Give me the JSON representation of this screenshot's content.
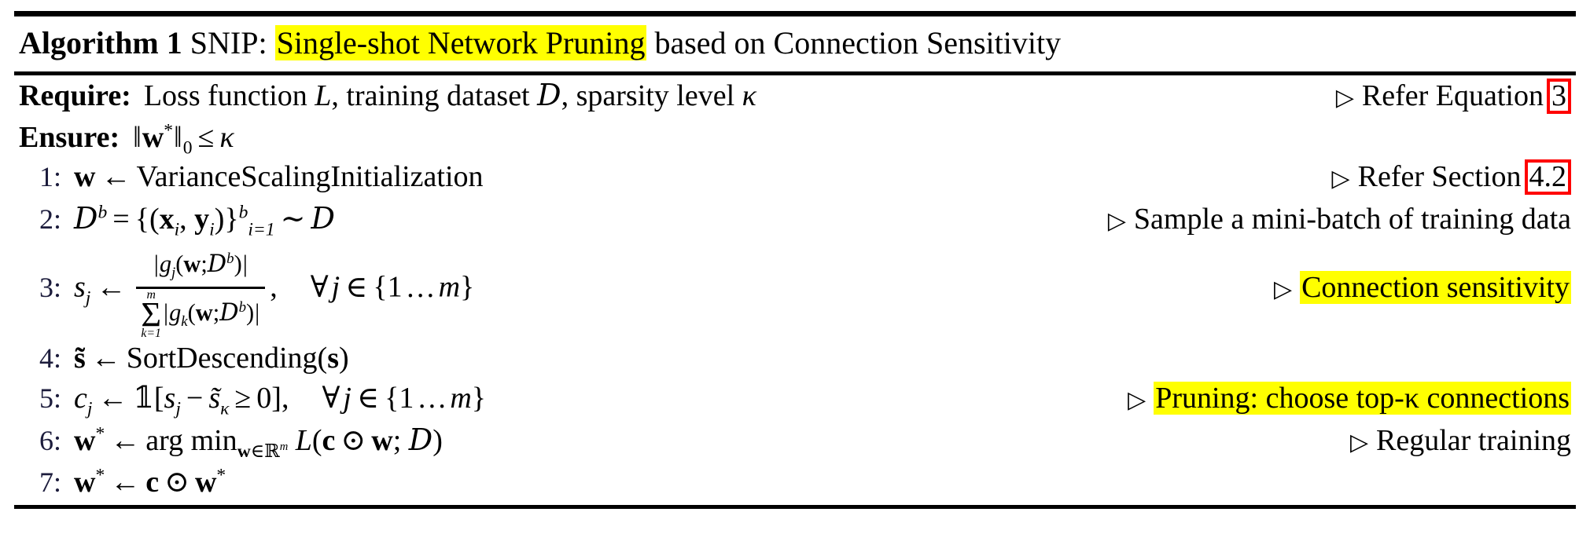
{
  "title": {
    "label": "Algorithm 1",
    "name": "SNIP:",
    "highlight": "Single-shot Network Pruning",
    "rest": "based on Connection Sensitivity"
  },
  "require": {
    "keyword": "Require:",
    "text_a": "Loss function",
    "sym_L": "L",
    "text_b": ", training dataset",
    "sym_D": "D",
    "text_c": ", sparsity level",
    "sym_kappa": "κ",
    "comment_marker": "▷",
    "comment": "Refer Equation",
    "ref": "3"
  },
  "ensure": {
    "keyword": "Ensure:",
    "norm_open": "‖",
    "sym_w": "w",
    "sym_star": "*",
    "norm_close": "‖",
    "sub_zero": "0",
    "rel": "≤",
    "sym_kappa": "κ"
  },
  "lines": [
    {
      "no": "1:",
      "body": "w ← VarianceScalingInitialization",
      "comment_marker": "▷",
      "comment": "Refer Section",
      "ref": "4.2",
      "ref_boxed": true,
      "highlight": false
    },
    {
      "no": "2:",
      "body": "D^b = {(x_i, y_i)}_{i=1}^b ∼ D",
      "comment_marker": "▷",
      "comment": "Sample a mini-batch of training data",
      "ref": "",
      "ref_boxed": false,
      "highlight": false
    },
    {
      "no": "3:",
      "body": "s_j ← |g_j(w;D^b)| / Σ_{k=1}^m |g_k(w;D^b)| ,  ∀j ∈ {1 … m}",
      "comment_marker": "▷",
      "comment": "Connection sensitivity",
      "ref": "",
      "ref_boxed": false,
      "highlight": true
    },
    {
      "no": "4:",
      "body": "s̃ ← SortDescending(s)",
      "comment_marker": "",
      "comment": "",
      "ref": "",
      "ref_boxed": false,
      "highlight": false
    },
    {
      "no": "5:",
      "body": "c_j ← 𝟙[s_j − s̃_κ ≥ 0] ,  ∀j ∈ {1 … m}",
      "comment_marker": "▷",
      "comment": "Pruning: choose top-κ connections",
      "ref": "",
      "ref_boxed": false,
      "highlight": true
    },
    {
      "no": "6:",
      "body": "w* ← arg min_{w∈R^m} L(c ⊙ w; D)",
      "comment_marker": "▷",
      "comment": "Regular training",
      "ref": "",
      "ref_boxed": false,
      "highlight": false
    },
    {
      "no": "7:",
      "body": "w* ← c ⊙ w*",
      "comment_marker": "",
      "comment": "",
      "ref": "",
      "ref_boxed": false,
      "highlight": false
    }
  ],
  "symbols": {
    "arrow_left": "←",
    "triangle": "▷",
    "forall": "∀",
    "elem": "∈",
    "sim": "∼",
    "geq": "≥",
    "leq": "≤",
    "odot": "⊙",
    "sum": "Σ",
    "kappa": "κ",
    "minus": "−",
    "dots": "…",
    "indicator": "𝟙",
    "sort_fn": "SortDescending",
    "init_fn": "VarianceScalingInitialization",
    "argmin": "arg min"
  },
  "colors": {
    "highlight": "#ffff00",
    "ref_box": "#ff0000",
    "line_number": "#1c1c3c",
    "rule": "#000000"
  }
}
